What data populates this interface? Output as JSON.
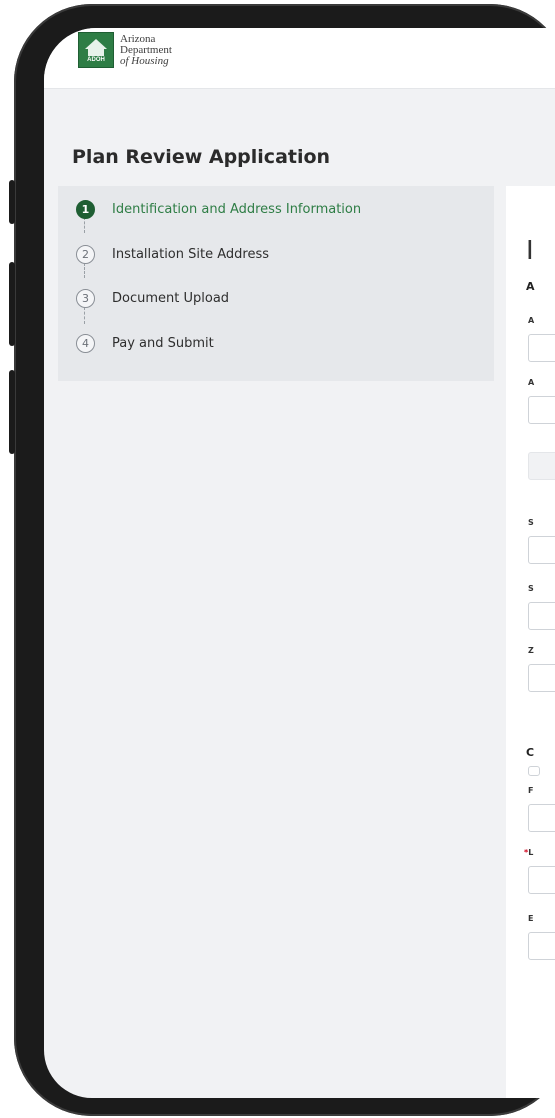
{
  "header": {
    "logo_acronym": "ADOH",
    "logo_lines": [
      "Arizona",
      "Department",
      "of Housing"
    ]
  },
  "page_title": "Plan Review Application",
  "steps": [
    {
      "number": "1",
      "label": "Identification and Address Information",
      "active": true
    },
    {
      "number": "2",
      "label": "Installation Site Address",
      "active": false
    },
    {
      "number": "3",
      "label": "Document Upload",
      "active": false
    },
    {
      "number": "4",
      "label": "Pay and Submit",
      "active": false
    }
  ],
  "content": {
    "title_fragment": "I",
    "section_a": "A",
    "label_a1": "A",
    "label_a2": "A",
    "label_s1": "S",
    "label_s2": "S",
    "label_z": "Z",
    "section_c": "C",
    "label_f": "F",
    "label_l_marker": "*",
    "label_l": "L",
    "label_e": "E"
  },
  "colors": {
    "brand_green": "#2e7d45",
    "active_step": "#1f5e33",
    "required": "#d0021b"
  }
}
